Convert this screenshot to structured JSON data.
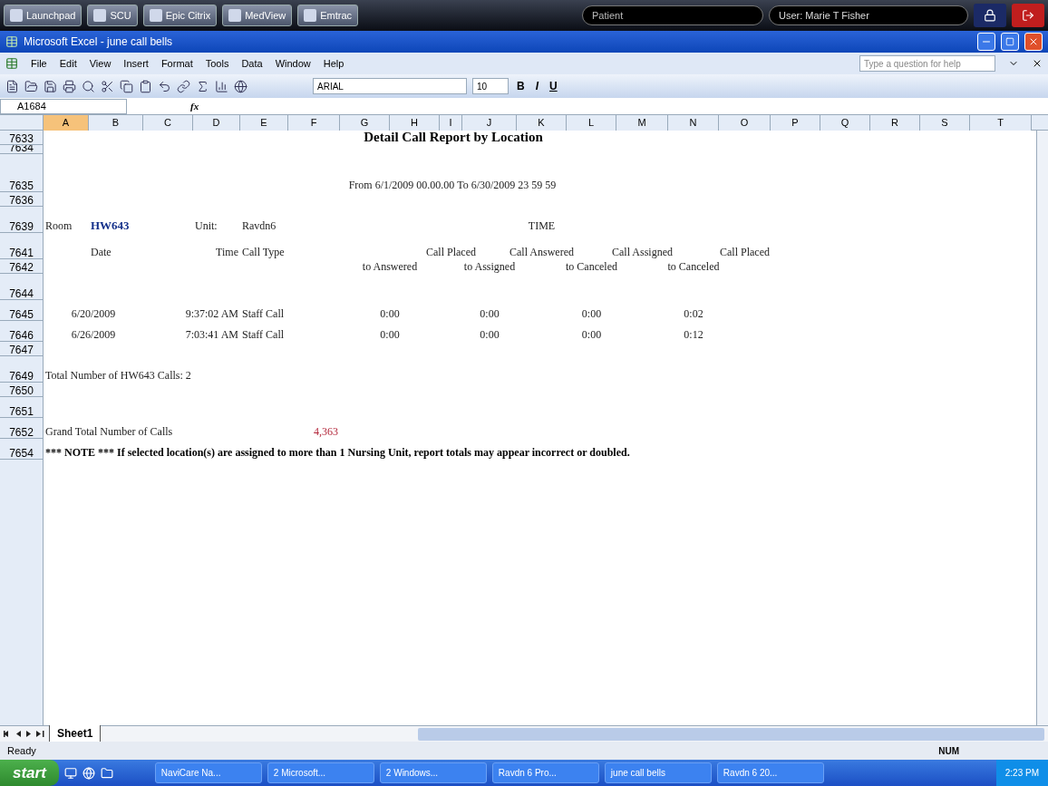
{
  "launchpad": {
    "buttons": [
      {
        "label": "Launchpad"
      },
      {
        "label": "SCU"
      },
      {
        "label": "Epic Citrix"
      },
      {
        "label": "MedView"
      },
      {
        "label": "Emtrac"
      }
    ],
    "patient": "Patient",
    "user": "User: Marie T Fisher"
  },
  "window": {
    "title": "Microsoft Excel - june call bells"
  },
  "menu": [
    "File",
    "Edit",
    "View",
    "Insert",
    "Format",
    "Tools",
    "Data",
    "Window",
    "Help"
  ],
  "help_field": {
    "placeholder": "Type a question for help"
  },
  "toolbar": {
    "font": "ARIAL",
    "size": "10",
    "format_buttons": [
      "B",
      "I",
      "U"
    ]
  },
  "name_box": "A1684",
  "function_label": "fx",
  "columns": [
    {
      "label": "A",
      "selected": true
    },
    {
      "label": "B",
      "selected": false
    },
    {
      "label": "C",
      "selected": false
    },
    {
      "label": "D",
      "selected": false
    },
    {
      "label": "E",
      "selected": false
    },
    {
      "label": "F",
      "selected": false
    },
    {
      "label": "G",
      "selected": false
    },
    {
      "label": "H",
      "selected": false
    },
    {
      "label": "I",
      "selected": false
    },
    {
      "label": "J",
      "selected": false
    },
    {
      "label": "K",
      "selected": false
    },
    {
      "label": "L",
      "selected": false
    },
    {
      "label": "M",
      "selected": false
    },
    {
      "label": "N",
      "selected": false
    },
    {
      "label": "O",
      "selected": false
    },
    {
      "label": "P",
      "selected": false
    },
    {
      "label": "Q",
      "selected": false
    },
    {
      "label": "R",
      "selected": false
    },
    {
      "label": "S",
      "selected": false
    },
    {
      "label": "T",
      "selected": false
    }
  ],
  "row_numbers": [
    "7633",
    "7634",
    "7635",
    "7636",
    "7639",
    "7641",
    "7642",
    "7644",
    "7645",
    "7646",
    "7647",
    "7649",
    "7650",
    "7651",
    "7652",
    "7654"
  ],
  "report": {
    "title": "Detail Call Report by Location",
    "date_range": "From 6/1/2009 00.00.00 To 6/30/2009 23 59 59",
    "room_label": "Room",
    "room": "HW643",
    "unit_label": "Unit:",
    "unit": "Ravdn6",
    "time_header": "TIME",
    "headers": {
      "date": "Date",
      "time": "Time",
      "call_type": "Call Type",
      "metrics": [
        {
          "line1": "Call Placed",
          "line2": "to Answered"
        },
        {
          "line1": "Call Answered",
          "line2": "to Assigned"
        },
        {
          "line1": "Call Assigned",
          "line2": "to Canceled"
        },
        {
          "line1": "Call Placed",
          "line2": "to Canceled"
        }
      ]
    },
    "calls": [
      {
        "date": "6/20/2009",
        "time": "9:37:02 AM",
        "type": "Staff Call",
        "values": [
          "0:00",
          "0:00",
          "0:00",
          "0:02"
        ]
      },
      {
        "date": "6/26/2009",
        "time": "7:03:41 AM",
        "type": "Staff Call",
        "values": [
          "0:00",
          "0:00",
          "0:00",
          "0:12"
        ]
      }
    ],
    "total": "Total Number of HW643 Calls: 2",
    "grand_total_label": "Grand Total Number of Calls",
    "grand_total": "4,363",
    "note": "*** NOTE ***  If selected location(s) are assigned to more than 1 Nursing Unit, report totals may appear incorrect or doubled."
  },
  "sheet_tabs": [
    {
      "label": "Sheet1",
      "selected": true
    }
  ],
  "status_bar": {
    "text": "Ready",
    "indicator": "NUM"
  },
  "taskbar": {
    "start": "start",
    "items": [
      {
        "label": "NaviCare Na..."
      },
      {
        "label": "2 Microsoft..."
      },
      {
        "label": "2 Windows..."
      },
      {
        "label": "Ravdn 6 Pro..."
      },
      {
        "label": "june call bells"
      },
      {
        "label": "Ravdn 6 20..."
      }
    ],
    "clock": "2:23 PM"
  }
}
